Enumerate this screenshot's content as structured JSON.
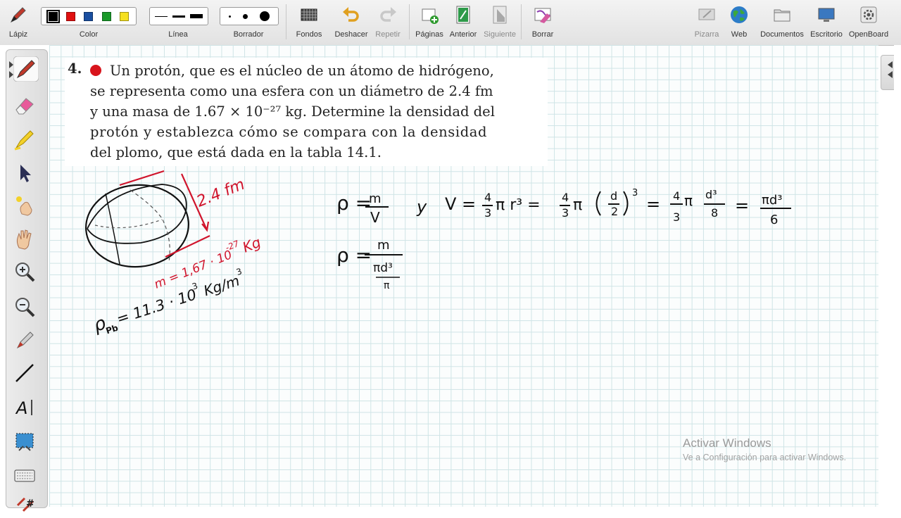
{
  "toolbar": {
    "pen_label": "Lápiz",
    "color_label": "Color",
    "line_label": "Línea",
    "eraser_label": "Borrador",
    "backgrounds_label": "Fondos",
    "undo_label": "Deshacer",
    "redo_label": "Repetir",
    "pages_label": "Páginas",
    "previous_label": "Anterior",
    "next_label": "Siguiente",
    "clear_label": "Borrar",
    "board_label": "Pizarra",
    "web_label": "Web",
    "documents_label": "Documentos",
    "desktop_label": "Escritorio",
    "openboard_label": "OpenBoard",
    "colors": [
      "#000000",
      "#e01010",
      "#1a4fa0",
      "#1a9a2a",
      "#f5e020"
    ]
  },
  "sidebar": {
    "tools": [
      "pen-icon",
      "eraser-icon",
      "highlighter-icon",
      "pointer-icon",
      "laser-pointer-icon",
      "hand-icon",
      "zoom-in-icon",
      "zoom-out-icon",
      "capture-pen-icon",
      "line-icon",
      "text-icon",
      "screen-capture-icon",
      "keyboard-icon",
      "grid-icon"
    ]
  },
  "problem": {
    "number": "4.",
    "lines": [
      "Un protón, que es el núcleo de un átomo de hidrógeno,",
      "se representa como una esfera con un diámetro de 2.4 fm",
      "y una masa de 1.67 × 10⁻²⁷ kg. Determine la densidad del",
      "protón y establezca cómo se compara con la densidad",
      "del plomo, que está dada en la tabla 14.1."
    ]
  },
  "handwriting": {
    "diameter": "2.4 fm",
    "mass_m": "m = 1,67 · 10",
    "mass_exp": "-27",
    "mass_unit": "Kg",
    "lead_rho": "ρ",
    "lead_sub": "Pb",
    "lead_value": "= 11.3 · 10",
    "lead_exp": "3",
    "lead_unit": "Kg/m",
    "lead_unit_exp": "3",
    "eq1_rho": "ρ =",
    "eq1_num": "m",
    "eq1_den": "V",
    "eq1_y": "y",
    "eq1_v": "V =",
    "eq1_f1_num": "4",
    "eq1_f1_den": "3",
    "eq1_pi_r3": "π r³ =",
    "eq1_f2_num": "4",
    "eq1_f2_den": "3",
    "eq1_pi": "π",
    "eq1_d": "d",
    "eq1_two": "2",
    "eq1_cube": "3",
    "eq1_eq": "=",
    "eq1_f3_num": "4",
    "eq1_f3_den": "3",
    "eq1_pi2": "π",
    "eq1_d3": "d³",
    "eq1_eight": "8",
    "eq1_eq2": "=",
    "eq1_pid3": "πd³",
    "eq1_six": "6",
    "eq2_rho": "ρ =",
    "eq2_num": "m",
    "eq2_den": "πd³",
    "eq2_den2": "π"
  },
  "watermark": {
    "title": "Activar Windows",
    "subtitle": "Ve a Configuración para activar Windows."
  }
}
